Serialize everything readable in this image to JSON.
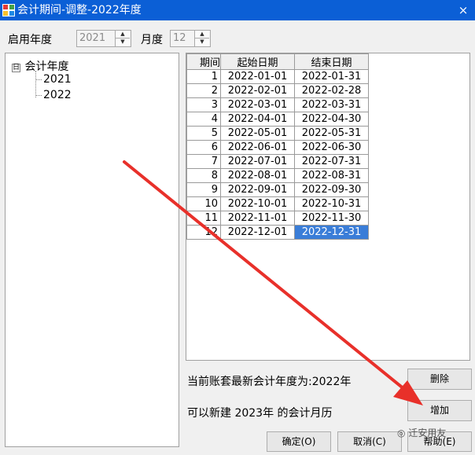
{
  "window": {
    "title": "会计期间-调整-2022年度",
    "close_glyph": "×"
  },
  "controls": {
    "start_year_label": "启用年度",
    "start_year_value": "2021",
    "month_label": "月度",
    "month_value": "12"
  },
  "tree": {
    "expander": "日",
    "root_label": "会计年度",
    "children": [
      "2021",
      "2022"
    ]
  },
  "table": {
    "headers": [
      "期间",
      "起始日期",
      "结束日期"
    ],
    "rows": [
      [
        "1",
        "2022-01-01",
        "2022-01-31"
      ],
      [
        "2",
        "2022-02-01",
        "2022-02-28"
      ],
      [
        "3",
        "2022-03-01",
        "2022-03-31"
      ],
      [
        "4",
        "2022-04-01",
        "2022-04-30"
      ],
      [
        "5",
        "2022-05-01",
        "2022-05-31"
      ],
      [
        "6",
        "2022-06-01",
        "2022-06-30"
      ],
      [
        "7",
        "2022-07-01",
        "2022-07-31"
      ],
      [
        "8",
        "2022-08-01",
        "2022-08-31"
      ],
      [
        "9",
        "2022-09-01",
        "2022-09-30"
      ],
      [
        "10",
        "2022-10-01",
        "2022-10-31"
      ],
      [
        "11",
        "2022-11-01",
        "2022-11-30"
      ],
      [
        "12",
        "2022-12-01",
        "2022-12-31"
      ]
    ],
    "selected_cell": "2022-12-31"
  },
  "info": {
    "latest_year_text": "当前账套最新会计年度为:2022年",
    "can_create_text": "可以新建 2023年 的会计月历"
  },
  "buttons": {
    "delete": "删除",
    "add": "增加",
    "ok": "确定(O)",
    "cancel": "取消(C)",
    "help": "帮助(E)"
  },
  "watermark": {
    "text": "迁安用友"
  },
  "colors": {
    "titlebar": "#0b5fd6",
    "selection": "#3a7dd8",
    "arrow": "#e8302a"
  },
  "icons": {
    "app": "grid-app-icon",
    "spin_up": "caret-up-icon",
    "spin_down": "caret-down-icon",
    "annotation": "red-arrow-icon"
  }
}
